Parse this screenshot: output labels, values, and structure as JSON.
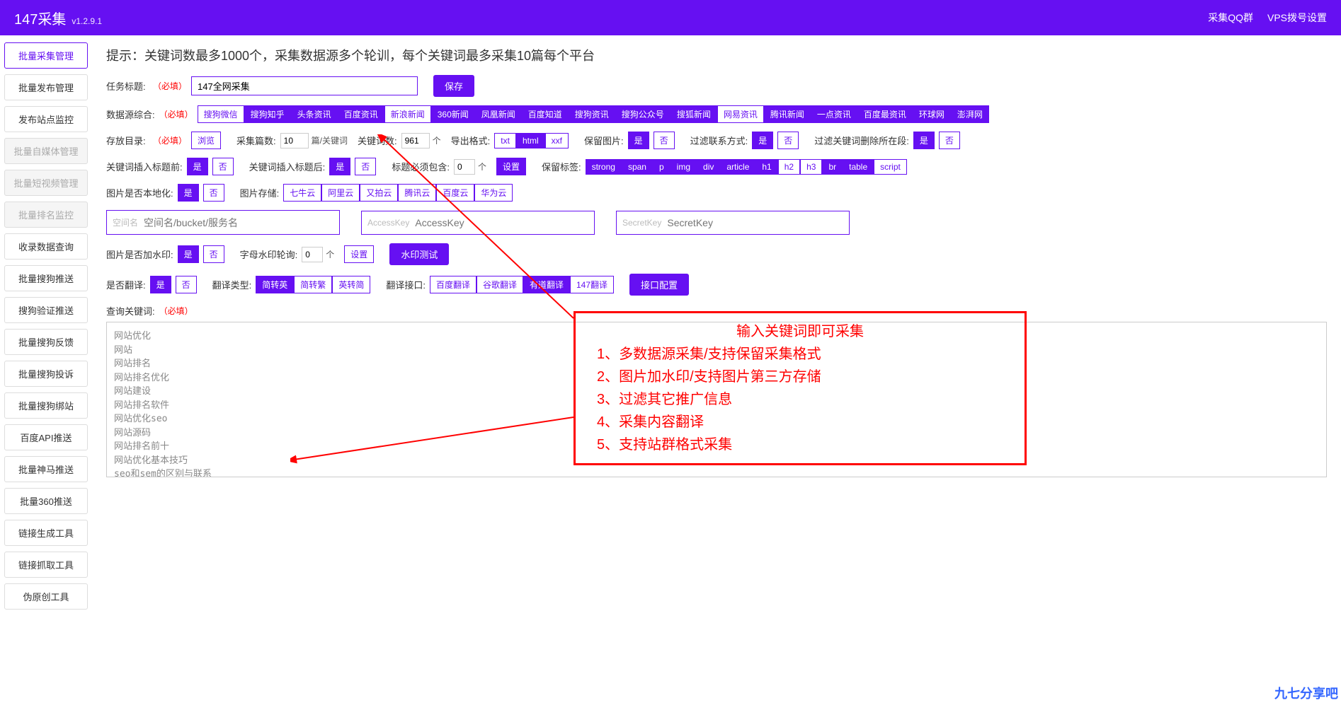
{
  "header": {
    "title": "147采集",
    "version": "v1.2.9.1",
    "links": {
      "qq": "采集QQ群",
      "vps": "VPS拨号设置"
    }
  },
  "sidebar": {
    "items": [
      {
        "label": "批量采集管理",
        "state": "active"
      },
      {
        "label": "批量发布管理",
        "state": "normal"
      },
      {
        "label": "发布站点监控",
        "state": "normal"
      },
      {
        "label": "批量自媒体管理",
        "state": "disabled"
      },
      {
        "label": "批量短视频管理",
        "state": "disabled"
      },
      {
        "label": "批量排名监控",
        "state": "disabled"
      },
      {
        "label": "收录数据查询",
        "state": "normal"
      },
      {
        "label": "批量搜狗推送",
        "state": "normal"
      },
      {
        "label": "搜狗验证推送",
        "state": "normal"
      },
      {
        "label": "批量搜狗反馈",
        "state": "normal"
      },
      {
        "label": "批量搜狗投诉",
        "state": "normal"
      },
      {
        "label": "批量搜狗绑站",
        "state": "normal"
      },
      {
        "label": "百度API推送",
        "state": "normal"
      },
      {
        "label": "批量神马推送",
        "state": "normal"
      },
      {
        "label": "批量360推送",
        "state": "normal"
      },
      {
        "label": "链接生成工具",
        "state": "normal"
      },
      {
        "label": "链接抓取工具",
        "state": "normal"
      },
      {
        "label": "伪原创工具",
        "state": "normal"
      }
    ]
  },
  "main": {
    "hint": "提示：关键词数最多1000个，采集数据源多个轮训，每个关键词最多采集10篇每个平台",
    "task": {
      "label": "任务标题:",
      "req": "（必填）",
      "value": "147全网采集",
      "save": "保存"
    },
    "sources": {
      "label": "数据源综合:",
      "req": "（必填）",
      "items": [
        {
          "label": "搜狗微信",
          "on": false
        },
        {
          "label": "搜狗知乎",
          "on": true
        },
        {
          "label": "头条资讯",
          "on": true
        },
        {
          "label": "百度资讯",
          "on": true
        },
        {
          "label": "新浪新闻",
          "on": false
        },
        {
          "label": "360新闻",
          "on": true
        },
        {
          "label": "凤凰新闻",
          "on": true
        },
        {
          "label": "百度知道",
          "on": true
        },
        {
          "label": "搜狗资讯",
          "on": true
        },
        {
          "label": "搜狗公众号",
          "on": true
        },
        {
          "label": "搜狐新闻",
          "on": true
        },
        {
          "label": "网易资讯",
          "on": false
        },
        {
          "label": "腾讯新闻",
          "on": true
        },
        {
          "label": "一点资讯",
          "on": true
        },
        {
          "label": "百度最资讯",
          "on": true
        },
        {
          "label": "环球网",
          "on": true
        },
        {
          "label": "澎湃网",
          "on": true
        }
      ]
    },
    "storage": {
      "label": "存放目录:",
      "req": "（必填）",
      "browse": "浏览",
      "count_label": "采集篇数:",
      "count_value": "10",
      "count_suffix": "篇/关键词",
      "kw_label": "关键词数:",
      "kw_value": "961",
      "kw_suffix": "个",
      "format_label": "导出格式:",
      "formats": [
        {
          "label": "txt",
          "on": false
        },
        {
          "label": "html",
          "on": true
        },
        {
          "label": "xxf",
          "on": false
        }
      ],
      "keepimg_label": "保留图片:",
      "yes": "是",
      "no": "否",
      "filter_contact_label": "过滤联系方式:",
      "filter_kw_label": "过滤关键词删除所在段:"
    },
    "insert": {
      "before_label": "关键词插入标题前:",
      "after_label": "关键词插入标题后:",
      "yes": "是",
      "no": "否",
      "must_label": "标题必须包含:",
      "must_value": "0",
      "must_suffix": "个",
      "set": "设置",
      "keep_tags_label": "保留标签:",
      "tags": [
        {
          "label": "strong",
          "on": true
        },
        {
          "label": "span",
          "on": true
        },
        {
          "label": "p",
          "on": true
        },
        {
          "label": "img",
          "on": true
        },
        {
          "label": "div",
          "on": true
        },
        {
          "label": "article",
          "on": true
        },
        {
          "label": "h1",
          "on": true
        },
        {
          "label": "h2",
          "on": false
        },
        {
          "label": "h3",
          "on": false
        },
        {
          "label": "br",
          "on": true
        },
        {
          "label": "table",
          "on": true
        },
        {
          "label": "script",
          "on": false
        }
      ]
    },
    "localize": {
      "label": "图片是否本地化:",
      "yes": "是",
      "no": "否",
      "storage_label": "图片存储:",
      "providers": [
        {
          "label": "七牛云",
          "on": false
        },
        {
          "label": "阿里云",
          "on": false
        },
        {
          "label": "又拍云",
          "on": false
        },
        {
          "label": "腾讯云",
          "on": false
        },
        {
          "label": "百度云",
          "on": false
        },
        {
          "label": "华为云",
          "on": false
        }
      ]
    },
    "cloud": {
      "space_label": "空间名",
      "space_placeholder": "空间名/bucket/服务名",
      "ak_label": "AccessKey",
      "ak_placeholder": "AccessKey",
      "sk_label": "SecretKey",
      "sk_placeholder": "SecretKey"
    },
    "watermark": {
      "label": "图片是否加水印:",
      "yes": "是",
      "no": "否",
      "rotate_label": "字母水印轮询:",
      "rotate_value": "0",
      "rotate_suffix": "个",
      "set": "设置",
      "test": "水印测试"
    },
    "translate": {
      "label": "是否翻译:",
      "yes": "是",
      "no": "否",
      "type_label": "翻译类型:",
      "types": [
        {
          "label": "简转英",
          "on": true
        },
        {
          "label": "简转繁",
          "on": false
        },
        {
          "label": "英转简",
          "on": false
        }
      ],
      "iface_label": "翻译接口:",
      "ifaces": [
        {
          "label": "百度翻译",
          "on": false
        },
        {
          "label": "谷歌翻译",
          "on": false
        },
        {
          "label": "有道翻译",
          "on": true
        },
        {
          "label": "147翻译",
          "on": false
        }
      ],
      "config": "接口配置"
    },
    "keywords": {
      "label": "查询关键词:",
      "req": "（必填）",
      "text": "网站优化\n网站\n网站排名\n网站排名优化\n网站建设\n网站排名软件\n网站优化seo\n网站源码\n网站排名前十\n网站优化基本技巧\nseo和sem的区别与联系\n网站搭建\n网站排名查询\n网站优化培训\nseo是什么意思"
    },
    "annotation": {
      "title": "输入关键词即可采集",
      "lines": [
        "1、多数据源采集/支持保留采集格式",
        "2、图片加水印/支持图片第三方存储",
        "3、过滤其它推广信息",
        "4、采集内容翻译",
        "5、支持站群格式采集"
      ]
    },
    "corner": "九七分享吧"
  }
}
